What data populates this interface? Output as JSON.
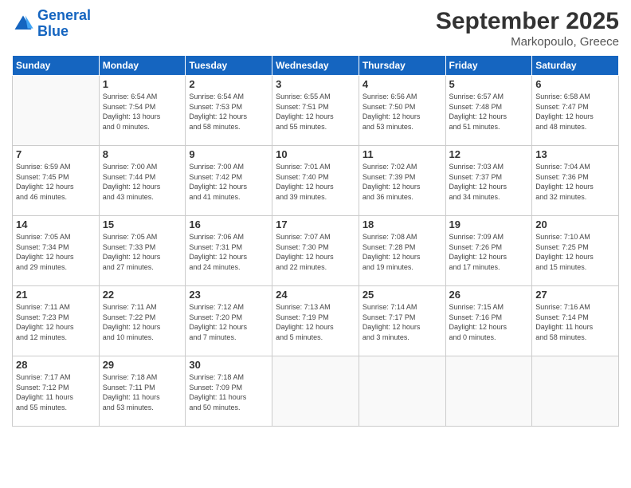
{
  "header": {
    "logo_line1": "General",
    "logo_line2": "Blue",
    "title": "September 2025",
    "subtitle": "Markopoulo, Greece"
  },
  "weekdays": [
    "Sunday",
    "Monday",
    "Tuesday",
    "Wednesday",
    "Thursday",
    "Friday",
    "Saturday"
  ],
  "weeks": [
    [
      {
        "day": "",
        "info": ""
      },
      {
        "day": "1",
        "info": "Sunrise: 6:54 AM\nSunset: 7:54 PM\nDaylight: 13 hours\nand 0 minutes."
      },
      {
        "day": "2",
        "info": "Sunrise: 6:54 AM\nSunset: 7:53 PM\nDaylight: 12 hours\nand 58 minutes."
      },
      {
        "day": "3",
        "info": "Sunrise: 6:55 AM\nSunset: 7:51 PM\nDaylight: 12 hours\nand 55 minutes."
      },
      {
        "day": "4",
        "info": "Sunrise: 6:56 AM\nSunset: 7:50 PM\nDaylight: 12 hours\nand 53 minutes."
      },
      {
        "day": "5",
        "info": "Sunrise: 6:57 AM\nSunset: 7:48 PM\nDaylight: 12 hours\nand 51 minutes."
      },
      {
        "day": "6",
        "info": "Sunrise: 6:58 AM\nSunset: 7:47 PM\nDaylight: 12 hours\nand 48 minutes."
      }
    ],
    [
      {
        "day": "7",
        "info": "Sunrise: 6:59 AM\nSunset: 7:45 PM\nDaylight: 12 hours\nand 46 minutes."
      },
      {
        "day": "8",
        "info": "Sunrise: 7:00 AM\nSunset: 7:44 PM\nDaylight: 12 hours\nand 43 minutes."
      },
      {
        "day": "9",
        "info": "Sunrise: 7:00 AM\nSunset: 7:42 PM\nDaylight: 12 hours\nand 41 minutes."
      },
      {
        "day": "10",
        "info": "Sunrise: 7:01 AM\nSunset: 7:40 PM\nDaylight: 12 hours\nand 39 minutes."
      },
      {
        "day": "11",
        "info": "Sunrise: 7:02 AM\nSunset: 7:39 PM\nDaylight: 12 hours\nand 36 minutes."
      },
      {
        "day": "12",
        "info": "Sunrise: 7:03 AM\nSunset: 7:37 PM\nDaylight: 12 hours\nand 34 minutes."
      },
      {
        "day": "13",
        "info": "Sunrise: 7:04 AM\nSunset: 7:36 PM\nDaylight: 12 hours\nand 32 minutes."
      }
    ],
    [
      {
        "day": "14",
        "info": "Sunrise: 7:05 AM\nSunset: 7:34 PM\nDaylight: 12 hours\nand 29 minutes."
      },
      {
        "day": "15",
        "info": "Sunrise: 7:05 AM\nSunset: 7:33 PM\nDaylight: 12 hours\nand 27 minutes."
      },
      {
        "day": "16",
        "info": "Sunrise: 7:06 AM\nSunset: 7:31 PM\nDaylight: 12 hours\nand 24 minutes."
      },
      {
        "day": "17",
        "info": "Sunrise: 7:07 AM\nSunset: 7:30 PM\nDaylight: 12 hours\nand 22 minutes."
      },
      {
        "day": "18",
        "info": "Sunrise: 7:08 AM\nSunset: 7:28 PM\nDaylight: 12 hours\nand 19 minutes."
      },
      {
        "day": "19",
        "info": "Sunrise: 7:09 AM\nSunset: 7:26 PM\nDaylight: 12 hours\nand 17 minutes."
      },
      {
        "day": "20",
        "info": "Sunrise: 7:10 AM\nSunset: 7:25 PM\nDaylight: 12 hours\nand 15 minutes."
      }
    ],
    [
      {
        "day": "21",
        "info": "Sunrise: 7:11 AM\nSunset: 7:23 PM\nDaylight: 12 hours\nand 12 minutes."
      },
      {
        "day": "22",
        "info": "Sunrise: 7:11 AM\nSunset: 7:22 PM\nDaylight: 12 hours\nand 10 minutes."
      },
      {
        "day": "23",
        "info": "Sunrise: 7:12 AM\nSunset: 7:20 PM\nDaylight: 12 hours\nand 7 minutes."
      },
      {
        "day": "24",
        "info": "Sunrise: 7:13 AM\nSunset: 7:19 PM\nDaylight: 12 hours\nand 5 minutes."
      },
      {
        "day": "25",
        "info": "Sunrise: 7:14 AM\nSunset: 7:17 PM\nDaylight: 12 hours\nand 3 minutes."
      },
      {
        "day": "26",
        "info": "Sunrise: 7:15 AM\nSunset: 7:16 PM\nDaylight: 12 hours\nand 0 minutes."
      },
      {
        "day": "27",
        "info": "Sunrise: 7:16 AM\nSunset: 7:14 PM\nDaylight: 11 hours\nand 58 minutes."
      }
    ],
    [
      {
        "day": "28",
        "info": "Sunrise: 7:17 AM\nSunset: 7:12 PM\nDaylight: 11 hours\nand 55 minutes."
      },
      {
        "day": "29",
        "info": "Sunrise: 7:18 AM\nSunset: 7:11 PM\nDaylight: 11 hours\nand 53 minutes."
      },
      {
        "day": "30",
        "info": "Sunrise: 7:18 AM\nSunset: 7:09 PM\nDaylight: 11 hours\nand 50 minutes."
      },
      {
        "day": "",
        "info": ""
      },
      {
        "day": "",
        "info": ""
      },
      {
        "day": "",
        "info": ""
      },
      {
        "day": "",
        "info": ""
      }
    ]
  ]
}
